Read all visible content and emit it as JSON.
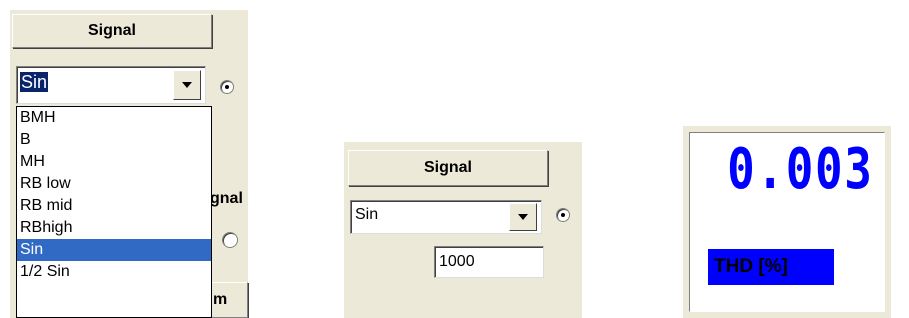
{
  "panel1": {
    "signal_button": "Signal",
    "combo_value": "Sin",
    "radio_selected": true,
    "dropdown_options": [
      "BMH",
      "B",
      "MH",
      "RB low",
      "RB mid",
      "RBhigh",
      "Sin",
      "1/2 Sin"
    ],
    "dropdown_selected": "Sin",
    "hidden_label_fragment": "gnal",
    "hidden_footer_fragment": "m",
    "second_radio_selected": false
  },
  "panel2": {
    "signal_button": "Signal",
    "combo_value": "Sin",
    "radio_selected": true,
    "frequency_value": "1000"
  },
  "panel3": {
    "display_value": "0.003",
    "label": "THD [%]",
    "display_color": "#0000ff"
  }
}
